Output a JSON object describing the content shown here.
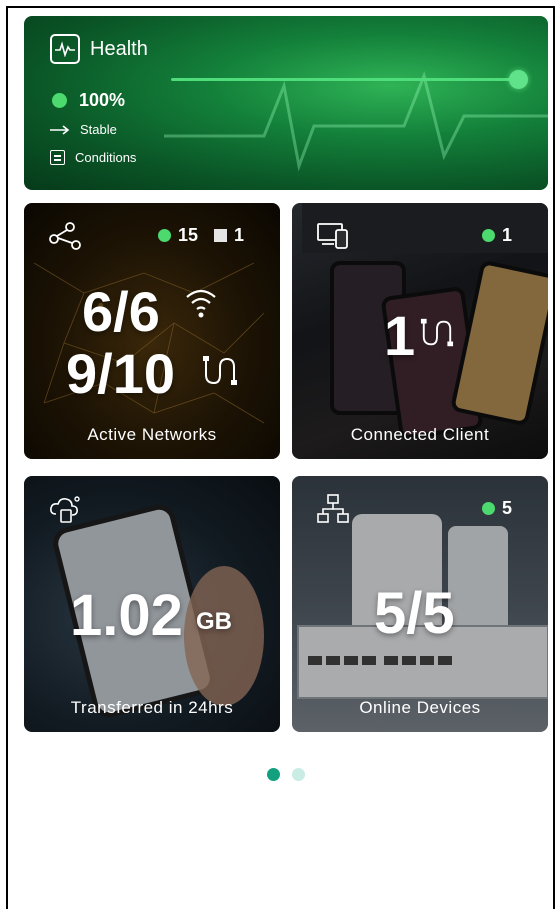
{
  "health": {
    "title": "Health",
    "percent": "100%",
    "percent_value": 1.0,
    "status": "Stable",
    "conditions_label": "Conditions"
  },
  "tiles": [
    {
      "caption": "Active Networks",
      "stat_green": "15",
      "stat_gray": "1",
      "big_primary": "6/6",
      "big_secondary": "9/10",
      "icon": "network-nodes-icon"
    },
    {
      "caption": "Connected Client",
      "stat_green": "1",
      "big_primary": "1",
      "icon": "devices-icon"
    },
    {
      "caption": "Transferred in 24hrs",
      "big_primary": "1.02",
      "unit": "GB",
      "icon": "data-transfer-icon"
    },
    {
      "caption": "Online Devices",
      "stat_green": "5",
      "big_primary": "5/5",
      "icon": "topology-icon"
    }
  ],
  "pager": {
    "count": 2,
    "active": 0
  },
  "colors": {
    "accent": "#12a07f",
    "status_green": "#4cd96e"
  }
}
